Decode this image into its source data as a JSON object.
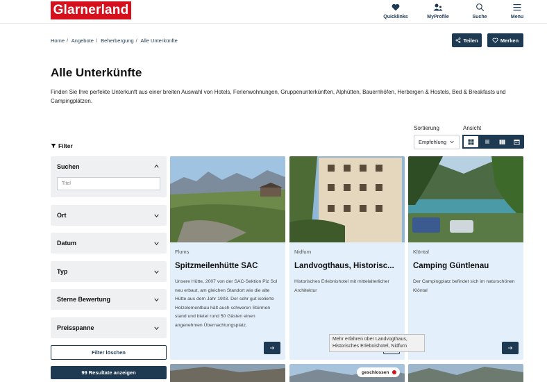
{
  "brand": {
    "logo": "Glarnerland",
    "accent": "#d4111c",
    "primary": "#1d3a52"
  },
  "nav": {
    "items": [
      {
        "label": "Quicklinks",
        "icon": "heart-icon"
      },
      {
        "label": "MyProfile",
        "icon": "user-icon"
      },
      {
        "label": "Suche",
        "icon": "search-icon"
      },
      {
        "label": "Menu",
        "icon": "menu-icon"
      }
    ]
  },
  "breadcrumb": [
    "Home",
    "Angebote",
    "Beherbergung",
    "Alle Unterkünfte"
  ],
  "breadcrumb_sep": "/",
  "actions": {
    "share": "Teilen",
    "save": "Merken"
  },
  "page": {
    "title": "Alle Unterkünfte",
    "intro": "Finden Sie Ihre perfekte Unterkunft aus einer breiten Auswahl von Hotels, Ferienwohnungen, Gruppenunterkünften, Alphütten, Bauernhöfen, Herbergen & Hostels, Bed & Breakfasts und Campingplätzen."
  },
  "sorting": {
    "label": "Sortierung",
    "value": "Empfehlung"
  },
  "view": {
    "label": "Ansicht",
    "options": [
      "grid-icon",
      "list-icon",
      "columns-icon",
      "calendar-icon"
    ],
    "active": 0
  },
  "filter": {
    "title": "Filter",
    "search_label": "Suchen",
    "search_placeholder": "Titel",
    "sections": [
      "Ort",
      "Datum",
      "Typ",
      "Sterne Bewertung",
      "Preisspanne"
    ],
    "clear": "Filter löschen",
    "results": "99 Resultate anzeigen"
  },
  "cards": [
    {
      "location": "Flums",
      "title": "Spitzmeilenhütte SAC",
      "description": "Unsere Hütte, 2007 von der SAC-Sektion Piz Sol neu erbaut, am gleichen Standort wie die alte Hütte aus dem Jahr 1903. Der sehr gut isolierte Holzelementbau hält auch schweren Stürmen stand und bietet rund 50 Gästen einen angenehmen Übernachtungsplatz."
    },
    {
      "location": "Nidfurn",
      "title": "Landvogthaus, Historisc...",
      "description": "Historisches Erlebnishotel mit mittelalterlicher Architektur"
    },
    {
      "location": "Klöntal",
      "title": "Camping Güntlenau",
      "description": "Der Campingplatz befindet sich im naturschönen Klöntal"
    }
  ],
  "tooltip": "Mehr erfahren über Landvogthaus, Historisches Erlebnishotel, Nidfurn",
  "badge": "geschlossen"
}
